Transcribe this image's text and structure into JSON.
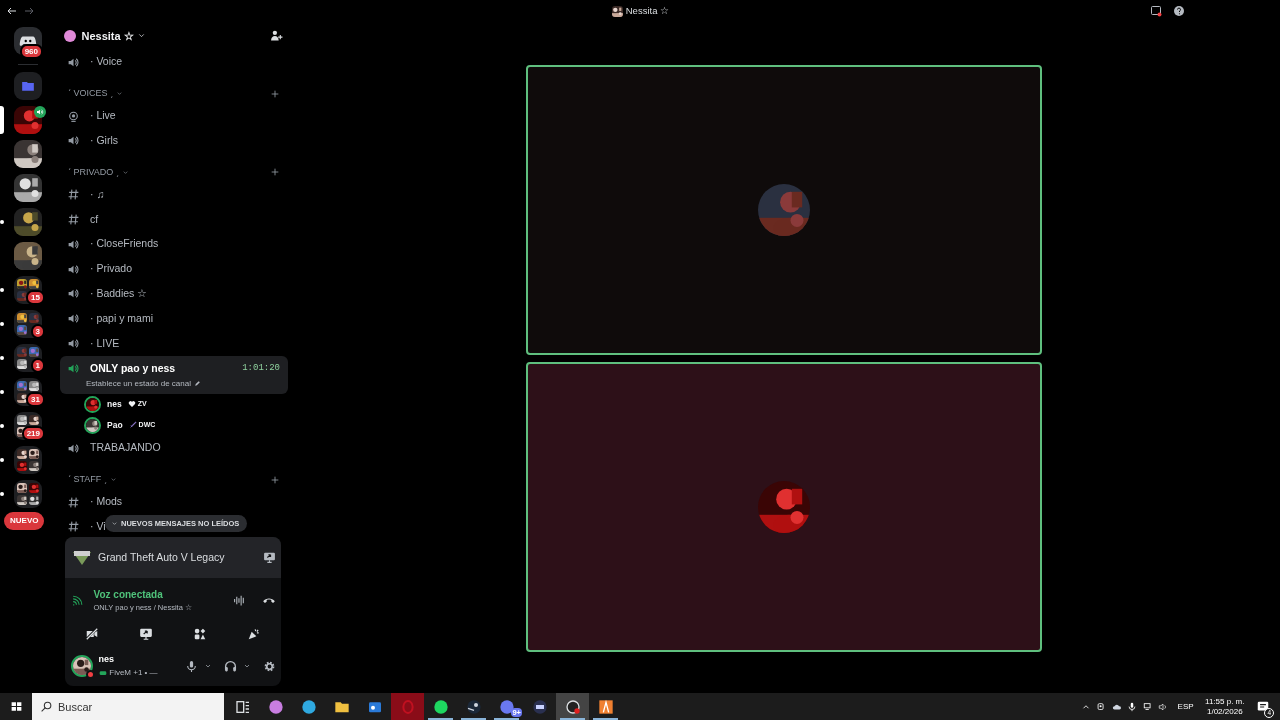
{
  "title_bar": {
    "title": "Nessita ☆"
  },
  "servers": [
    {
      "kind": "home",
      "badge": "960",
      "unread": false,
      "selected": false,
      "in_voice": false
    },
    {
      "kind": "folder-open",
      "unread": false,
      "selected": false,
      "in_voice": false
    },
    {
      "kind": "server",
      "unread": false,
      "selected": true,
      "in_voice": true
    },
    {
      "kind": "server",
      "unread": false,
      "selected": false,
      "in_voice": false
    },
    {
      "kind": "server",
      "unread": false,
      "selected": false,
      "in_voice": false
    },
    {
      "kind": "server",
      "unread": true,
      "selected": false,
      "in_voice": false
    },
    {
      "kind": "server",
      "unread": false,
      "selected": false,
      "in_voice": false
    },
    {
      "kind": "folder",
      "badge": "15",
      "unread": true,
      "selected": false,
      "in_voice": false
    },
    {
      "kind": "folder",
      "badge": "3",
      "unread": true,
      "selected": false,
      "in_voice": false
    },
    {
      "kind": "folder",
      "badge": "1",
      "unread": true,
      "selected": false,
      "in_voice": false
    },
    {
      "kind": "folder",
      "badge": "31",
      "unread": true,
      "selected": false,
      "in_voice": false
    },
    {
      "kind": "folder",
      "badge": "219",
      "unread": true,
      "selected": false,
      "in_voice": false
    },
    {
      "kind": "folder",
      "unread": true,
      "selected": false,
      "in_voice": false
    },
    {
      "kind": "folder",
      "unread": true,
      "selected": false,
      "in_voice": false
    }
  ],
  "new_pill": "NUEVO",
  "server_header": {
    "name": "Nessita ☆"
  },
  "channels": [
    {
      "kind": "voice",
      "name": "· Voice",
      "selected": false
    },
    {
      "kind": "category",
      "name": "ˊ VOICES ˏ"
    },
    {
      "kind": "stage",
      "name": "· Live",
      "selected": false
    },
    {
      "kind": "voice",
      "name": "· Girls",
      "selected": false
    },
    {
      "kind": "category",
      "name": "ˊ PRIVADO ˏ"
    },
    {
      "kind": "text",
      "name": "· ♫",
      "selected": false
    },
    {
      "kind": "text",
      "name": "cf",
      "selected": false
    },
    {
      "kind": "voice",
      "name": "· CloseFriends",
      "selected": false
    },
    {
      "kind": "voice",
      "name": "· Privado",
      "selected": false
    },
    {
      "kind": "voice",
      "name": "· Baddies ☆",
      "selected": false
    },
    {
      "kind": "voice",
      "name": "· papi y mami",
      "selected": false
    },
    {
      "kind": "voice",
      "name": "· LIVE",
      "selected": false
    },
    {
      "kind": "voice",
      "name": "ONLY pao y ness",
      "selected": true,
      "timer": "1:01:20",
      "status": "Establece un estado de canal",
      "users": [
        {
          "name": "nes",
          "tag": "ZV"
        },
        {
          "name": "Pao",
          "tag": "DWC"
        }
      ]
    },
    {
      "kind": "voice",
      "name": "TRABAJANDO",
      "selected": false
    },
    {
      "kind": "category",
      "name": "ˊ STAFF ˏ"
    },
    {
      "kind": "text",
      "name": "· Mods",
      "selected": false
    },
    {
      "kind": "text",
      "name": "· Vi",
      "selected": false
    }
  ],
  "unread_banner": "NUEVOS MENSAJES NO LEÍDOS",
  "activity": {
    "game": "Grand Theft Auto V Legacy"
  },
  "voice_panel": {
    "status": "Voz conectada",
    "channel": "ONLY pao y ness / Nessita ☆"
  },
  "user": {
    "name": "nes",
    "activity": "FiveM +1 • —",
    "do_not_disturb": true
  },
  "tiles": [
    {
      "speaking": true
    },
    {
      "speaking": true
    }
  ],
  "taskbar": {
    "search_placeholder": "Buscar",
    "apps": [
      {
        "kind": "taskview",
        "running": false,
        "active": false
      },
      {
        "kind": "copilot",
        "running": false,
        "active": false
      },
      {
        "kind": "edge",
        "running": false,
        "active": false
      },
      {
        "kind": "explorer",
        "running": false,
        "active": false
      },
      {
        "kind": "outlook",
        "running": false,
        "active": false
      },
      {
        "kind": "opera",
        "running": false,
        "active": false
      },
      {
        "kind": "spotify",
        "running": true,
        "active": false
      },
      {
        "kind": "steam",
        "running": true,
        "active": false
      },
      {
        "kind": "discord",
        "running": true,
        "active": false,
        "badge": "9+"
      },
      {
        "kind": "keyboard",
        "running": false,
        "active": false
      },
      {
        "kind": "obs",
        "running": true,
        "active": true
      },
      {
        "kind": "orange",
        "running": true,
        "active": false
      }
    ],
    "language": "ESP",
    "time": "11:55 p. m.",
    "date": "1/02/2026",
    "notifications": "4"
  }
}
